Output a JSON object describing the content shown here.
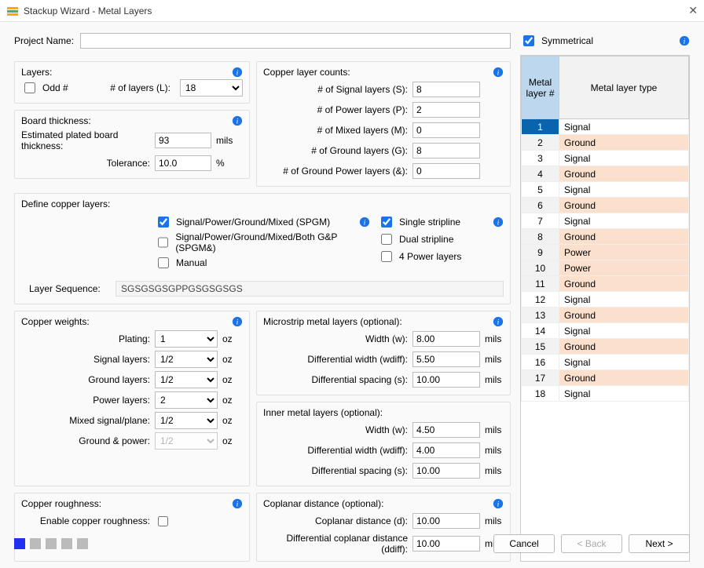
{
  "window": {
    "title": "Stackup Wizard - Metal Layers"
  },
  "project": {
    "label": "Project Name:",
    "value": ""
  },
  "symmetrical": {
    "label": "Symmetrical",
    "checked": true
  },
  "layers": {
    "title": "Layers:",
    "odd_label": "Odd #",
    "num_layers_label": "# of layers (L):",
    "num_layers_value": "18"
  },
  "board_thickness": {
    "title": "Board thickness:",
    "estimated_label": "Estimated plated board thickness:",
    "estimated_value": "93",
    "estimated_unit": "mils",
    "tolerance_label": "Tolerance:",
    "tolerance_value": "10.0",
    "tolerance_unit": "%"
  },
  "copper_counts": {
    "title": "Copper layer counts:",
    "signal_label": "# of Signal layers (S):",
    "signal_value": "8",
    "power_label": "# of Power layers (P):",
    "power_value": "2",
    "mixed_label": "# of Mixed layers (M):",
    "mixed_value": "0",
    "ground_label": "# of Ground layers (G):",
    "ground_value": "8",
    "gp_label": "# of Ground  Power layers (&):",
    "gp_value": "0"
  },
  "define": {
    "title": "Define copper layers:",
    "spgm_label": "Signal/Power/Ground/Mixed (SPGM)",
    "spgm_amp_label": "Signal/Power/Ground/Mixed/Both G&P (SPGM&)",
    "manual_label": "Manual",
    "single_label": "Single stripline",
    "dual_label": "Dual stripline",
    "four_label": "4 Power layers",
    "seq_label": "Layer Sequence:",
    "seq_value": "SGSGSGSGPPGSGSGSGS"
  },
  "weights": {
    "title": "Copper weights:",
    "unit": "oz",
    "plating_label": "Plating:",
    "plating_value": "1",
    "signal_label": "Signal layers:",
    "signal_value": "1/2",
    "ground_label": "Ground layers:",
    "ground_value": "1/2",
    "power_label": "Power layers:",
    "power_value": "2",
    "mixed_label": "Mixed signal/plane:",
    "mixed_value": "1/2",
    "gp_label": "Ground & power:",
    "gp_value": "1/2"
  },
  "microstrip": {
    "title": "Microstrip metal layers  (optional):",
    "width_label": "Width (w):",
    "width_value": "8.00",
    "diffw_label": "Differential width (wdiff):",
    "diffw_value": "5.50",
    "diffs_label": "Differential spacing (s):",
    "diffs_value": "10.00",
    "unit": "mils"
  },
  "inner": {
    "title": "Inner metal layers  (optional):",
    "width_label": "Width (w):",
    "width_value": "4.50",
    "diffw_label": "Differential width (wdiff):",
    "diffw_value": "4.00",
    "diffs_label": "Differential spacing (s):",
    "diffs_value": "10.00",
    "unit": "mils"
  },
  "roughness": {
    "title": "Copper roughness:",
    "enable_label": "Enable copper roughness:"
  },
  "coplanar": {
    "title": "Coplanar distance  (optional):",
    "d_label": "Coplanar distance (d):",
    "d_value": "10.00",
    "dd_label": "Differential coplanar distance (ddiff):",
    "dd_value": "10.00",
    "unit": "mils"
  },
  "table": {
    "header_metal": "Metal layer #",
    "header_type": "Metal layer type",
    "rows": [
      {
        "n": "1",
        "t": "Signal",
        "hl": false,
        "sel": true
      },
      {
        "n": "2",
        "t": "Ground",
        "hl": true
      },
      {
        "n": "3",
        "t": "Signal",
        "hl": false
      },
      {
        "n": "4",
        "t": "Ground",
        "hl": true
      },
      {
        "n": "5",
        "t": "Signal",
        "hl": false
      },
      {
        "n": "6",
        "t": "Ground",
        "hl": true
      },
      {
        "n": "7",
        "t": "Signal",
        "hl": false
      },
      {
        "n": "8",
        "t": "Ground",
        "hl": true
      },
      {
        "n": "9",
        "t": "Power",
        "hl": true
      },
      {
        "n": "10",
        "t": "Power",
        "hl": true
      },
      {
        "n": "11",
        "t": "Ground",
        "hl": true
      },
      {
        "n": "12",
        "t": "Signal",
        "hl": false
      },
      {
        "n": "13",
        "t": "Ground",
        "hl": true
      },
      {
        "n": "14",
        "t": "Signal",
        "hl": false
      },
      {
        "n": "15",
        "t": "Ground",
        "hl": true
      },
      {
        "n": "16",
        "t": "Signal",
        "hl": false
      },
      {
        "n": "17",
        "t": "Ground",
        "hl": true
      },
      {
        "n": "18",
        "t": "Signal",
        "hl": false
      }
    ]
  },
  "footer": {
    "cancel": "Cancel",
    "back": "< Back",
    "next": "Next >"
  }
}
